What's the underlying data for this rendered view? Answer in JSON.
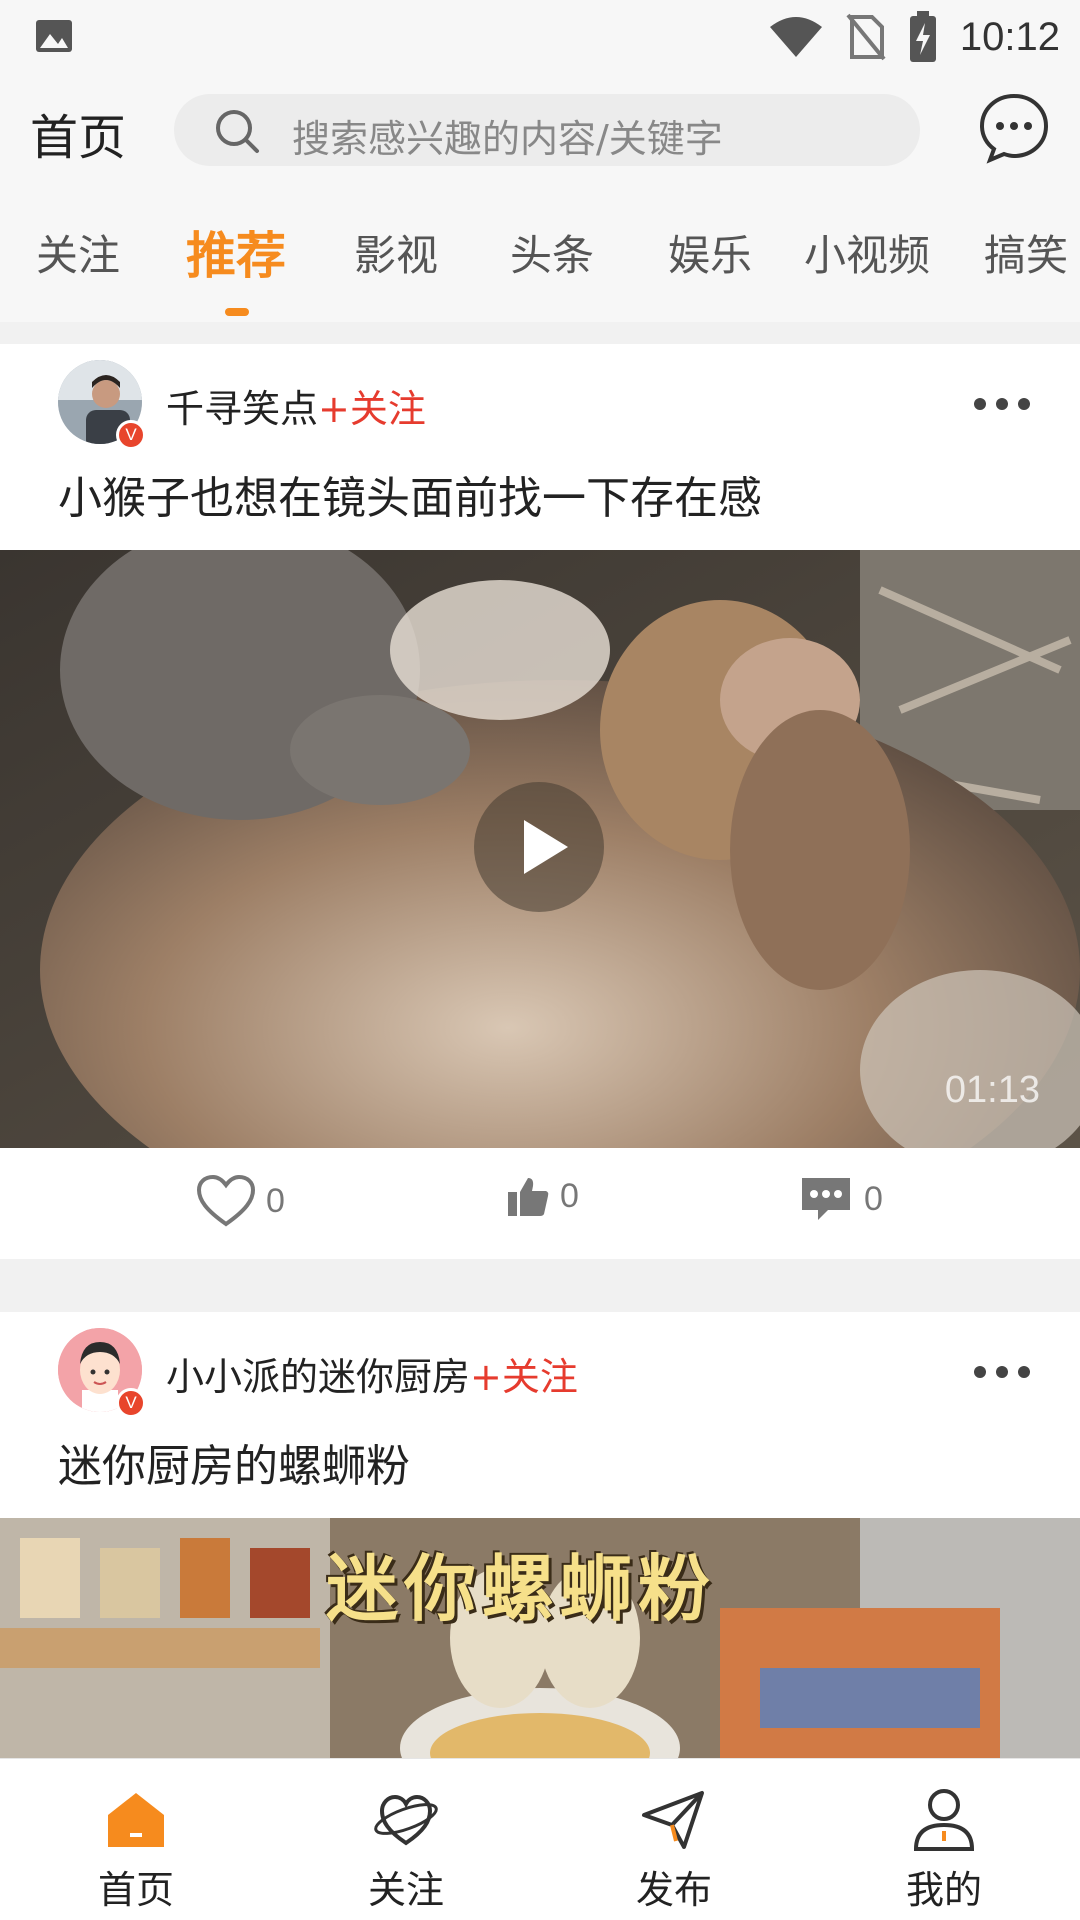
{
  "status_bar": {
    "time": "10:12"
  },
  "header": {
    "title": "首页",
    "search_placeholder": "搜索感兴趣的内容/关键字"
  },
  "tabs": [
    {
      "label": "关注",
      "active": false
    },
    {
      "label": "推荐",
      "active": true
    },
    {
      "label": "影视",
      "active": false
    },
    {
      "label": "头条",
      "active": false
    },
    {
      "label": "娱乐",
      "active": false
    },
    {
      "label": "小视频",
      "active": false
    },
    {
      "label": "搞笑",
      "active": false
    }
  ],
  "posts": [
    {
      "author": "千寻笑点",
      "follow_label": "+关注",
      "badge": "V",
      "title": "小猴子也想在镜头面前找一下存在感",
      "duration": "01:13",
      "likes": "0",
      "thumbs": "0",
      "comments": "0"
    },
    {
      "author": "小小派的迷你厨房",
      "follow_label": "+关注",
      "badge": "V",
      "title": "迷你厨房的螺蛳粉",
      "cover_text": "迷你螺蛳粉"
    }
  ],
  "bottom_nav": [
    {
      "label": "首页",
      "icon": "home-icon",
      "active": true
    },
    {
      "label": "关注",
      "icon": "heart-planet-icon",
      "active": false
    },
    {
      "label": "发布",
      "icon": "paper-plane-icon",
      "active": false
    },
    {
      "label": "我的",
      "icon": "user-icon",
      "active": false
    }
  ],
  "colors": {
    "accent": "#f68b1e",
    "follow": "#e63b2e"
  }
}
